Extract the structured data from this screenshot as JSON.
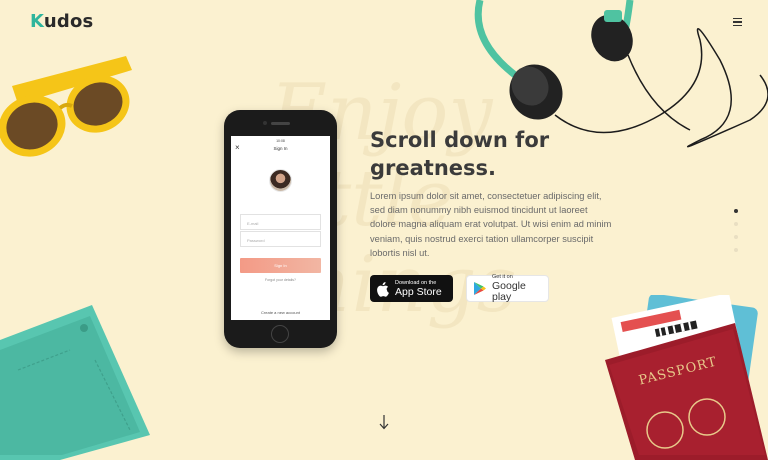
{
  "brand": {
    "logo_first": "K",
    "logo_rest": "udos",
    "accent": "#2fb59c"
  },
  "nav": {
    "menu_icon": "hamburger-icon"
  },
  "phone": {
    "status_time": "10:08",
    "title": "Sign In",
    "email_placeholder": "E-mail",
    "password_placeholder": "Password",
    "signin_button": "Sign In",
    "forgot_link": "Forgot your details?",
    "create_link": "Create a new account"
  },
  "hero": {
    "headline": "Scroll down for greatness.",
    "body": "Lorem ipsum dolor sit amet, consectetuer adipiscing elit, sed diam nonummy nibh euismod tincidunt ut laoreet dolore magna aliquam erat volutpat. Ut wisi enim ad minim veniam, quis nostrud exerci tation ullamcorper suscipit lobortis nisl ut."
  },
  "store_buttons": {
    "appstore_small": "Download on the",
    "appstore_big": "App Store",
    "googleplay_small": "Get it on",
    "googleplay_big": "Google play"
  },
  "pagination": {
    "count": 4,
    "active_index": 0
  },
  "decorations": {
    "passport_label": "PASSPORT"
  },
  "colors": {
    "background": "#fbf1d0",
    "signin_gradient": "#f39a86"
  }
}
